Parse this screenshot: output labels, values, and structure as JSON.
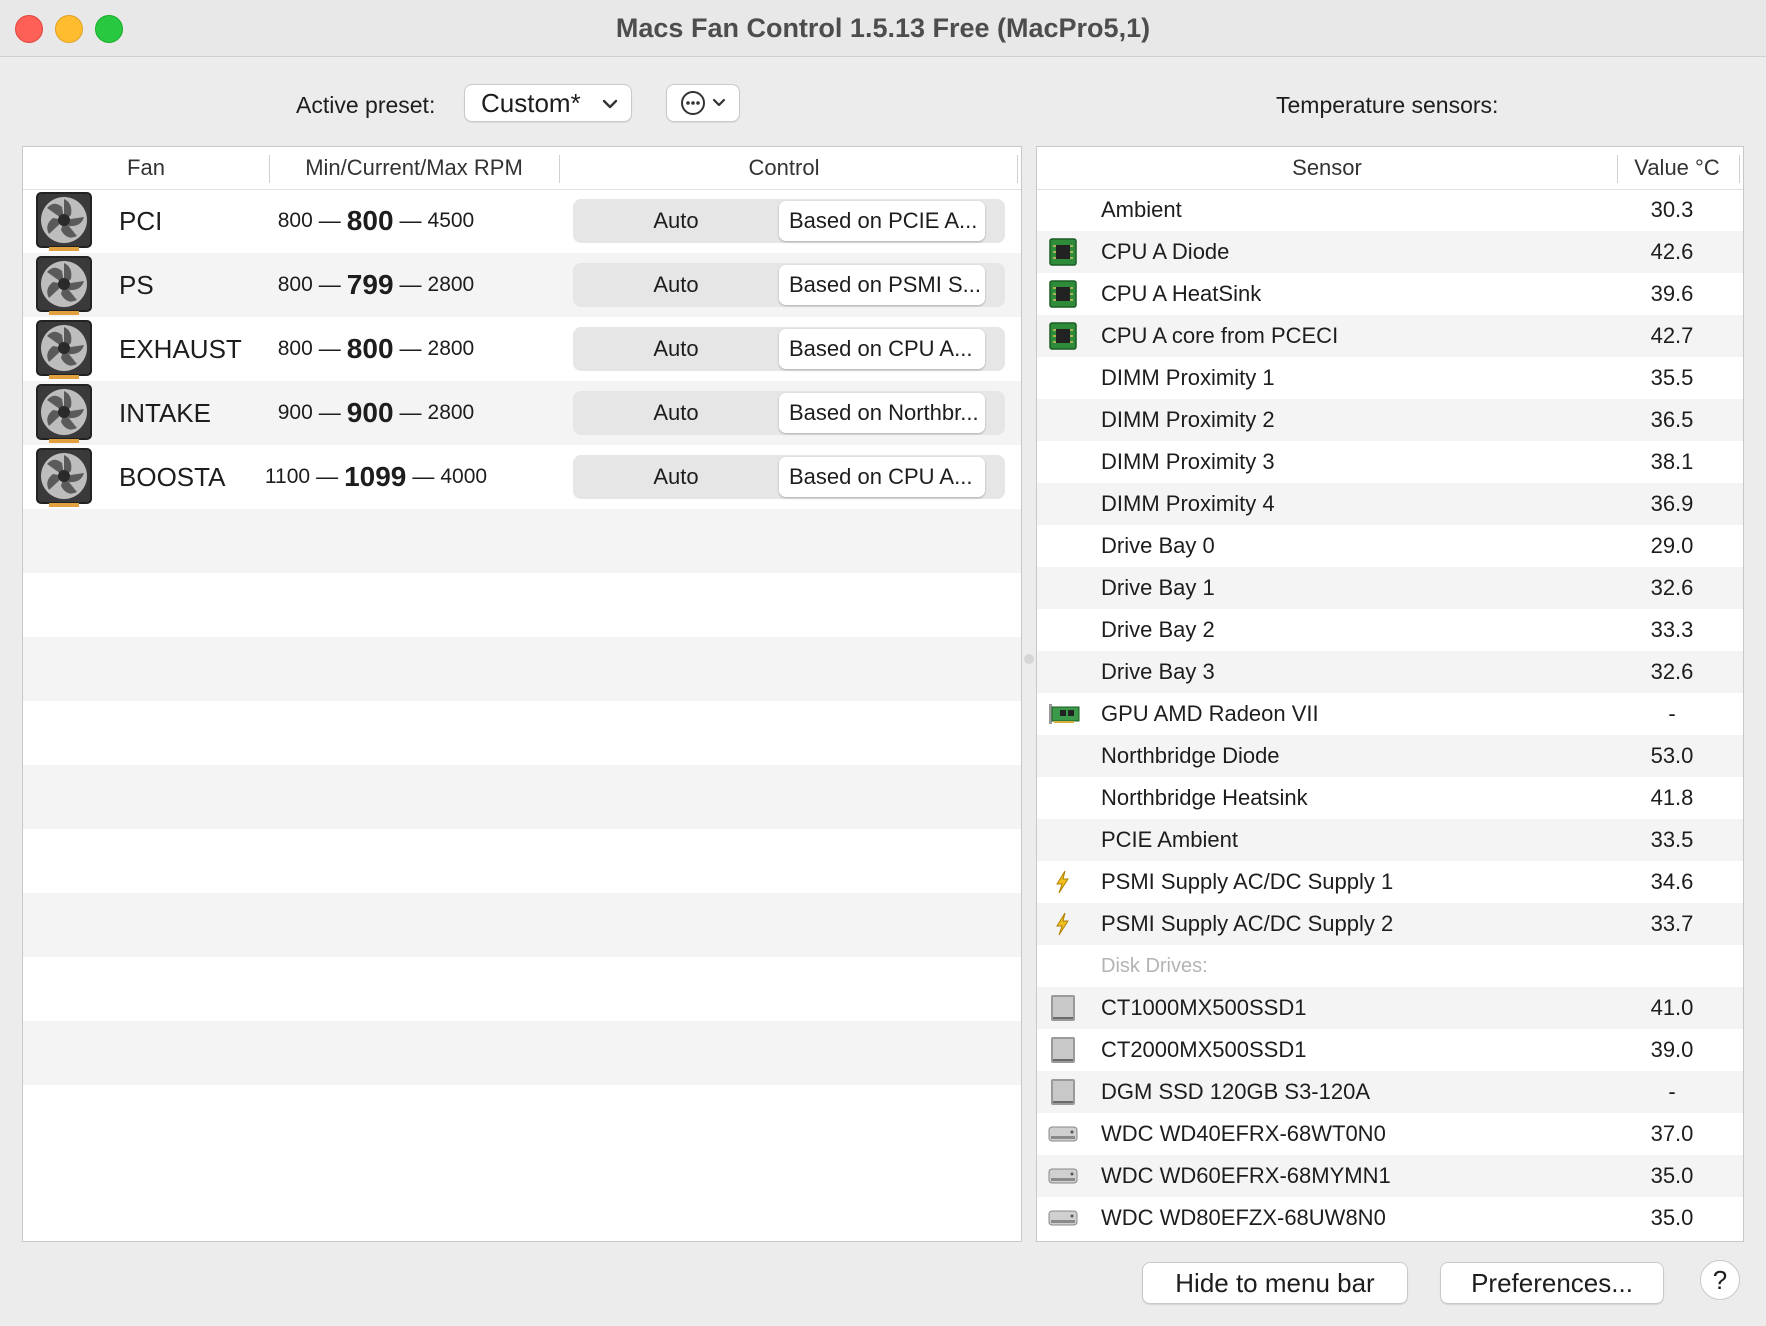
{
  "window": {
    "title": "Macs Fan Control 1.5.13 Free (MacPro5,1)"
  },
  "toolbar": {
    "preset_label": "Active preset:",
    "preset_value": "Custom*",
    "sensors_label": "Temperature sensors:"
  },
  "fan_table": {
    "headers": [
      "Fan",
      "Min/Current/Max RPM",
      "Control"
    ],
    "auto_label": "Auto",
    "rows": [
      {
        "name": "PCI",
        "min": "800",
        "current": "800",
        "max": "4500",
        "based": "Based on PCIE A..."
      },
      {
        "name": "PS",
        "min": "800",
        "current": "799",
        "max": "2800",
        "based": "Based on PSMI S..."
      },
      {
        "name": "EXHAUST",
        "min": "800",
        "current": "800",
        "max": "2800",
        "based": "Based on CPU A..."
      },
      {
        "name": "INTAKE",
        "min": "900",
        "current": "900",
        "max": "2800",
        "based": "Based on Northbr..."
      },
      {
        "name": "BOOSTA",
        "min": "1100",
        "current": "1099",
        "max": "4000",
        "based": "Based on CPU A..."
      }
    ]
  },
  "sensor_table": {
    "headers": [
      "Sensor",
      "Value °C"
    ],
    "rows": [
      {
        "name": "Ambient",
        "value": "30.3",
        "icon": "none"
      },
      {
        "name": "CPU A Diode",
        "value": "42.6",
        "icon": "cpu-chip-icon"
      },
      {
        "name": "CPU A HeatSink",
        "value": "39.6",
        "icon": "cpu-chip-icon"
      },
      {
        "name": "CPU A core from PCECI",
        "value": "42.7",
        "icon": "cpu-chip-icon"
      },
      {
        "name": "DIMM Proximity 1",
        "value": "35.5",
        "icon": "none"
      },
      {
        "name": "DIMM Proximity 2",
        "value": "36.5",
        "icon": "none"
      },
      {
        "name": "DIMM Proximity 3",
        "value": "38.1",
        "icon": "none"
      },
      {
        "name": "DIMM Proximity 4",
        "value": "36.9",
        "icon": "none"
      },
      {
        "name": "Drive Bay 0",
        "value": "29.0",
        "icon": "none"
      },
      {
        "name": "Drive Bay 1",
        "value": "32.6",
        "icon": "none"
      },
      {
        "name": "Drive Bay 2",
        "value": "33.3",
        "icon": "none"
      },
      {
        "name": "Drive Bay 3",
        "value": "32.6",
        "icon": "none"
      },
      {
        "name": "GPU AMD Radeon VII",
        "value": "-",
        "icon": "gpu-card-icon"
      },
      {
        "name": "Northbridge Diode",
        "value": "53.0",
        "icon": "none"
      },
      {
        "name": "Northbridge Heatsink",
        "value": "41.8",
        "icon": "none"
      },
      {
        "name": "PCIE Ambient",
        "value": "33.5",
        "icon": "none"
      },
      {
        "name": "PSMI Supply AC/DC Supply 1",
        "value": "34.6",
        "icon": "lightning-icon"
      },
      {
        "name": "PSMI Supply AC/DC Supply 2",
        "value": "33.7",
        "icon": "lightning-icon"
      }
    ],
    "group_label": "Disk Drives:",
    "disk_rows": [
      {
        "name": "CT1000MX500SSD1",
        "value": "41.0",
        "icon": "ssd-icon"
      },
      {
        "name": "CT2000MX500SSD1",
        "value": "39.0",
        "icon": "ssd-icon"
      },
      {
        "name": "DGM SSD 120GB S3-120A",
        "value": "-",
        "icon": "ssd-icon"
      },
      {
        "name": "WDC WD40EFRX-68WT0N0",
        "value": "37.0",
        "icon": "hdd-icon"
      },
      {
        "name": "WDC WD60EFRX-68MYMN1",
        "value": "35.0",
        "icon": "hdd-icon"
      },
      {
        "name": "WDC WD80EFZX-68UW8N0",
        "value": "35.0",
        "icon": "hdd-icon"
      }
    ]
  },
  "buttons": {
    "hide": "Hide to menu bar",
    "preferences": "Preferences...",
    "help": "?"
  }
}
